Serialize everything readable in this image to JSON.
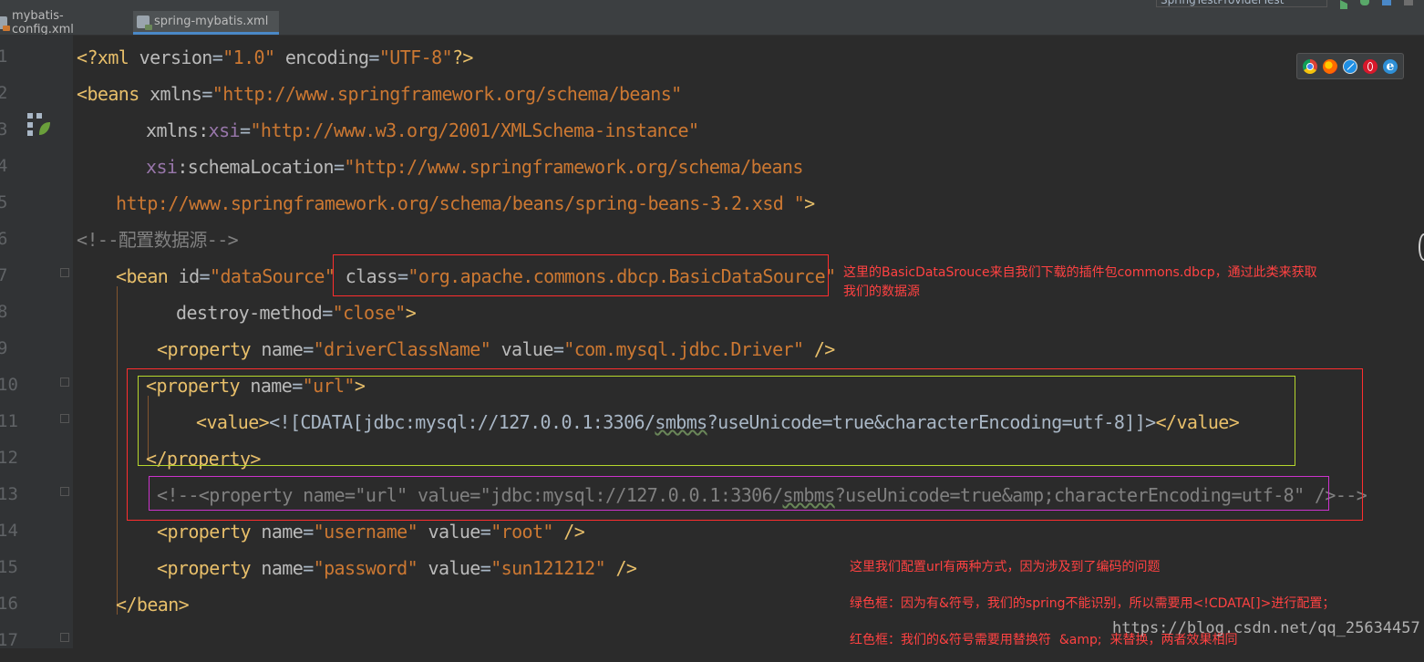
{
  "tabs": [
    {
      "label": "mybatis-config.xml",
      "active": false,
      "icon": "xml-file-icon"
    },
    {
      "label": "spring-mybatis.xml",
      "active": true,
      "icon": "spring-xml-file-icon"
    }
  ],
  "toolbar": {
    "run_config": "SpringTestProviderTest"
  },
  "line_numbers": [
    "1",
    "2",
    "3",
    "4",
    "5",
    "6",
    "7",
    "8",
    "9",
    "10",
    "11",
    "12",
    "13",
    "14",
    "15",
    "16",
    "17"
  ],
  "code": {
    "l1": {
      "t1": "<?xml ",
      "a1": "version",
      "e1": "=",
      "v1": "\"1.0\"",
      "s1": " ",
      "a2": "encoding",
      "e2": "=",
      "v2": "\"UTF-8\"",
      "t2": "?>"
    },
    "l2": {
      "t1": "<beans ",
      "a1": "xmlns",
      "e1": "=",
      "v1": "\"http://www.springframework.org/schema/beans\""
    },
    "l3": {
      "a1": "xmlns:",
      "ns": "xsi",
      "e1": "=",
      "v1": "\"http://www.w3.org/2001/XMLSchema-instance\""
    },
    "l4": {
      "ns": "xsi",
      "a1": ":schemaLocation",
      "e1": "=",
      "v1": "\"http://www.springframework.org/schema/beans"
    },
    "l5": {
      "v1": "http://www.springframework.org/schema/beans/spring-beans-3.2.xsd \"",
      "t1": ">"
    },
    "l6": {
      "c1": "<!--",
      "c2": "配置数据源",
      "c3": "-->"
    },
    "l7": {
      "t1": "<bean ",
      "a1": "id",
      "e1": "=",
      "v1": "\"dataSource\"",
      "s1": " ",
      "a2": "class",
      "e2": "=",
      "v2": "\"org.apache.commons.dbcp.BasicDataSource\""
    },
    "l8": {
      "a1": "destroy-method",
      "e1": "=",
      "v1": "\"close\"",
      "t1": ">"
    },
    "l9": {
      "t1": "<property ",
      "a1": "name",
      "e1": "=",
      "v1": "\"driverClassName\"",
      "s1": " ",
      "a2": "value",
      "e2": "=",
      "v2": "\"com.mysql.jdbc.Driver\"",
      "t2": " />"
    },
    "l10": {
      "t1": "<property ",
      "a1": "name",
      "e1": "=",
      "v1": "\"url\"",
      "t2": ">"
    },
    "l11": {
      "t1": "<value>",
      "p1": "<![CDATA[jdbc:mysql://127.0.0.1:3306/",
      "u1": "smbms",
      "p2": "?useUnicode=true&characterEncoding=utf-8]]>",
      "t2": "</value>"
    },
    "l12": {
      "t1": "</property>"
    },
    "l13": {
      "c1": "<!--<property name=\"url\" value=\"jdbc:mysql://127.0.0.1:3306/",
      "u1": "smbms",
      "c2": "?useUnicode=true&amp;characterEncoding=utf-8\" />-->"
    },
    "l14": {
      "t1": "<property ",
      "a1": "name",
      "e1": "=",
      "v1": "\"username\"",
      "s1": " ",
      "a2": "value",
      "e2": "=",
      "v2": "\"root\"",
      "t2": " />"
    },
    "l15": {
      "t1": "<property ",
      "a1": "name",
      "e1": "=",
      "v1": "\"password\"",
      "s1": " ",
      "a2": "value",
      "e2": "=",
      "v2": "\"sun121212\"",
      "t2": " />"
    },
    "l16": {
      "t1": "</bean>"
    }
  },
  "notes": {
    "n1": "这里的BasicDataSrouce来自我们下载的插件包commons.dbcp，通过此类来获取\n我们的数据源",
    "n2": "这里我们配置url有两种方式，因为涉及到了编码的问题",
    "n3": "绿色框：因为有&符号，我们的spring不能识别，所以需要用<!CDATA[]>进行配置；",
    "n4": "红色框：我们的&符号需要用替换符  &amp;  来替换，两者效果相同"
  },
  "watermark": "https://blog.csdn.net/qq_25634457",
  "browser_icons": [
    "chrome-icon",
    "firefox-icon",
    "safari-icon",
    "opera-icon",
    "ie-icon"
  ],
  "colors": {
    "background": "#2b2b2b",
    "tag": "#e8bf6a",
    "string": "#cc7832",
    "namespace": "#9876aa",
    "comment": "#808080",
    "note": "#ff4242"
  }
}
